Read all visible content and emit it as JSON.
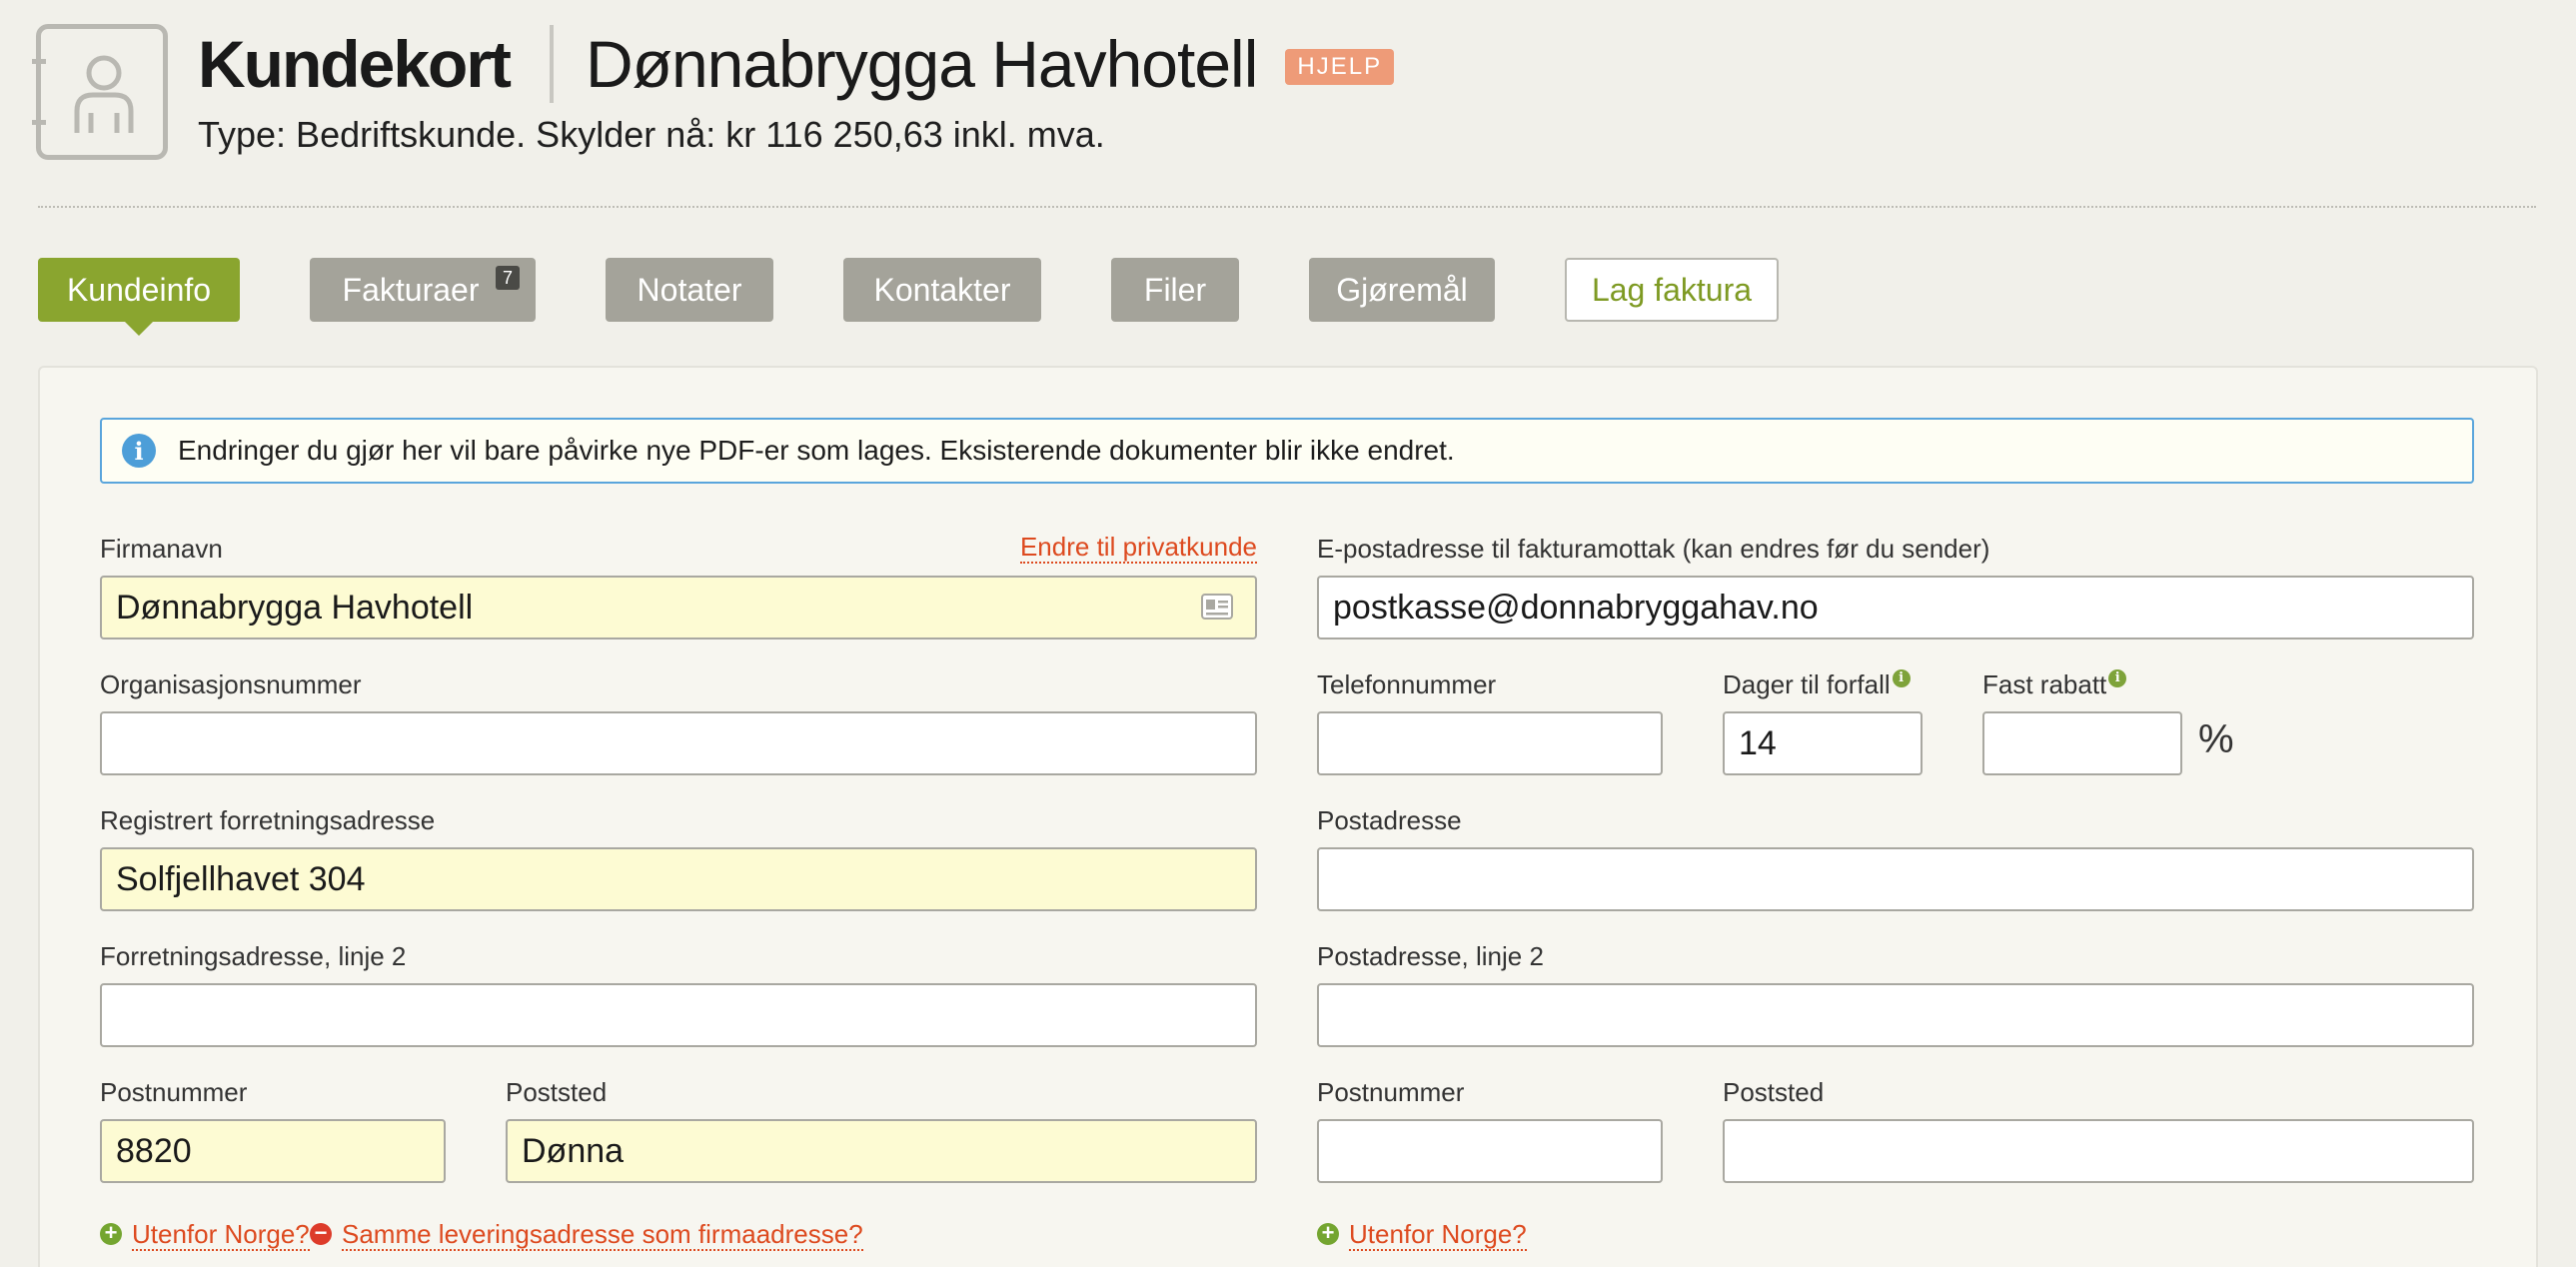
{
  "header": {
    "title": "Kundekort",
    "customer_name": "Dønnabrygga Havhotell",
    "help_badge": "HJELP",
    "subtitle": "Type: Bedriftskunde. Skylder nå: kr 116 250,63 inkl. mva."
  },
  "tabs": [
    {
      "label": "Kundeinfo",
      "active": true
    },
    {
      "label": "Fakturaer",
      "count": "7"
    },
    {
      "label": "Notater"
    },
    {
      "label": "Kontakter"
    },
    {
      "label": "Filer"
    },
    {
      "label": "Gjøremål"
    },
    {
      "label": "Lag faktura"
    }
  ],
  "info_message": "Endringer du gjør her vil bare påvirke nye PDF-er som lages. Eksisterende dokumenter blir ikke endret.",
  "form": {
    "company_name": {
      "label": "Firmanavn",
      "value": "Dønnabrygga Havhotell",
      "switch_link": "Endre til privatkunde"
    },
    "invoice_email": {
      "label": "E-postadresse til fakturamottak (kan endres før du sender)",
      "value": "postkasse@donnabryggahav.no"
    },
    "org_number": {
      "label": "Organisasjonsnummer",
      "value": ""
    },
    "phone": {
      "label": "Telefonnummer",
      "value": ""
    },
    "due_days": {
      "label": "Dager til forfall",
      "value": "14"
    },
    "fixed_discount": {
      "label": "Fast rabatt",
      "value": "",
      "unit": "%"
    },
    "business_address": {
      "label": "Registrert forretningsadresse",
      "value": "Solfjellhavet 304"
    },
    "postal_address": {
      "label": "Postadresse",
      "value": ""
    },
    "business_address_2": {
      "label": "Forretningsadresse, linje 2",
      "value": ""
    },
    "postal_address_2": {
      "label": "Postadresse, linje 2",
      "value": ""
    },
    "business_zip": {
      "label": "Postnummer",
      "value": "8820"
    },
    "business_city": {
      "label": "Poststed",
      "value": "Dønna"
    },
    "postal_zip": {
      "label": "Postnummer",
      "value": ""
    },
    "postal_city": {
      "label": "Poststed",
      "value": ""
    },
    "links": {
      "outside_norway": "Utenfor Norge?",
      "same_delivery": "Samme leveringsadresse som firmaadresse?",
      "outside_norway_postal": "Utenfor Norge?"
    }
  },
  "colors": {
    "accent_green": "#8aa52f",
    "tab_gray": "#a4a39a",
    "link_red": "#dd4a1f",
    "highlight_yellow": "#fdfbd3",
    "info_blue": "#5aa5dc"
  }
}
